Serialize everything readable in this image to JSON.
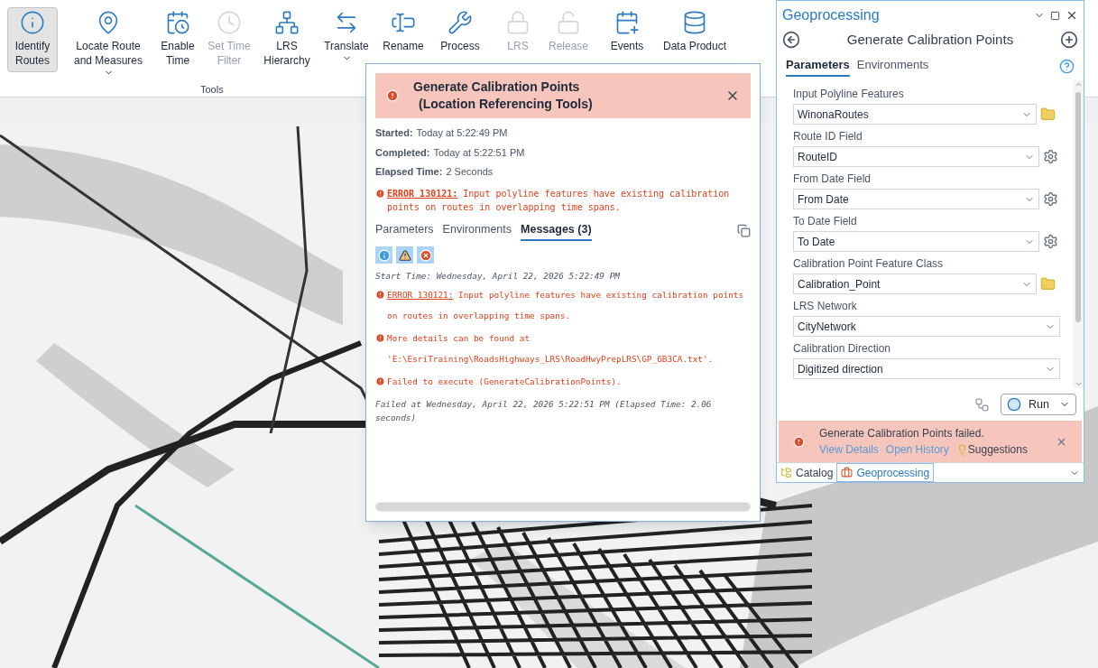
{
  "ribbon": {
    "buttons": [
      {
        "label": "Identify Routes",
        "selected": true,
        "disabled": false,
        "has_menu": false
      },
      {
        "label": "Locate Route and Measures",
        "selected": false,
        "disabled": false,
        "has_menu": true
      },
      {
        "label": "Enable Time",
        "selected": false,
        "disabled": false,
        "has_menu": false
      },
      {
        "label": "Set Time Filter",
        "selected": false,
        "disabled": true,
        "has_menu": false
      },
      {
        "label": "LRS Hierarchy",
        "selected": false,
        "disabled": false,
        "has_menu": false
      },
      {
        "label": "Translate",
        "selected": false,
        "disabled": false,
        "has_menu": true
      },
      {
        "label": "Rename",
        "selected": false,
        "disabled": false,
        "has_menu": false
      },
      {
        "label": "Process",
        "selected": false,
        "disabled": false,
        "has_menu": false
      },
      {
        "label": "LRS",
        "selected": false,
        "disabled": true,
        "has_menu": false
      },
      {
        "label": "Release",
        "selected": false,
        "disabled": true,
        "has_menu": false
      },
      {
        "label": "Events",
        "selected": false,
        "disabled": false,
        "has_menu": false
      },
      {
        "label": "Data Product",
        "selected": false,
        "disabled": false,
        "has_menu": false
      }
    ],
    "group_label": "Tools"
  },
  "details_dialog": {
    "title_lines": [
      "Generate Calibration Points",
      "(Location Referencing Tools)"
    ],
    "info": [
      {
        "label": "Started:",
        "value": "Today at 5:22:49 PM"
      },
      {
        "label": "Completed:",
        "value": "Today at 5:22:51 PM"
      },
      {
        "label": "Elapsed Time:",
        "value": "2 Seconds"
      }
    ],
    "summary_error": {
      "code": "ERROR 130121:",
      "text": "Input polyline features have existing calibration points on routes in overlapping time spans."
    },
    "tabs": [
      {
        "label": "Parameters",
        "selected": false
      },
      {
        "label": "Environments",
        "selected": false
      },
      {
        "label": "Messages (3)",
        "selected": true
      }
    ],
    "messages": [
      {
        "kind": "plain",
        "text": "Start Time: Wednesday, April 22, 2026 5:22:49 PM"
      },
      {
        "kind": "error",
        "code": "ERROR 130121:",
        "text": "Input polyline features have existing calibration points on routes in overlapping time spans."
      },
      {
        "kind": "error",
        "text": "More details can be found at 'E:\\EsriTraining\\RoadsHighways_LRS\\RoadHwyPrepLRS\\GP_6B3CA.txt'."
      },
      {
        "kind": "error",
        "text": "Failed to execute (GenerateCalibrationPoints)."
      },
      {
        "kind": "plain",
        "text": "Failed at Wednesday, April 22, 2026 5:22:51 PM (Elapsed Time: 2.06 seconds)"
      }
    ]
  },
  "geoprocessing": {
    "title": "Geoprocessing",
    "tool_title": "Generate Calibration Points",
    "tabs": [
      {
        "label": "Parameters",
        "selected": true
      },
      {
        "label": "Environments",
        "selected": false
      }
    ],
    "parameters": [
      {
        "label": "Input Polyline Features",
        "value": "WinonaRoutes",
        "kind": "folder"
      },
      {
        "label": "Route ID Field",
        "value": "RouteID",
        "kind": "gear"
      },
      {
        "label": "From Date Field",
        "value": "From Date",
        "kind": "gear"
      },
      {
        "label": "To Date Field",
        "value": "To Date",
        "kind": "gear"
      },
      {
        "label": "Calibration Point Feature Class",
        "value": "Calibration_Point",
        "kind": "folder"
      },
      {
        "label": "LRS Network",
        "value": "CityNetwork",
        "kind": "plain"
      },
      {
        "label": "Calibration Direction",
        "value": "Digitized direction",
        "kind": "plain"
      }
    ],
    "run_label": "Run",
    "banner": {
      "text": "Generate Calibration Points failed.",
      "links": [
        "View Details",
        "Open History"
      ],
      "suggestions": "Suggestions"
    },
    "bottom_tabs": [
      {
        "label": "Catalog",
        "selected": false
      },
      {
        "label": "Geoprocessing",
        "selected": true
      }
    ]
  }
}
